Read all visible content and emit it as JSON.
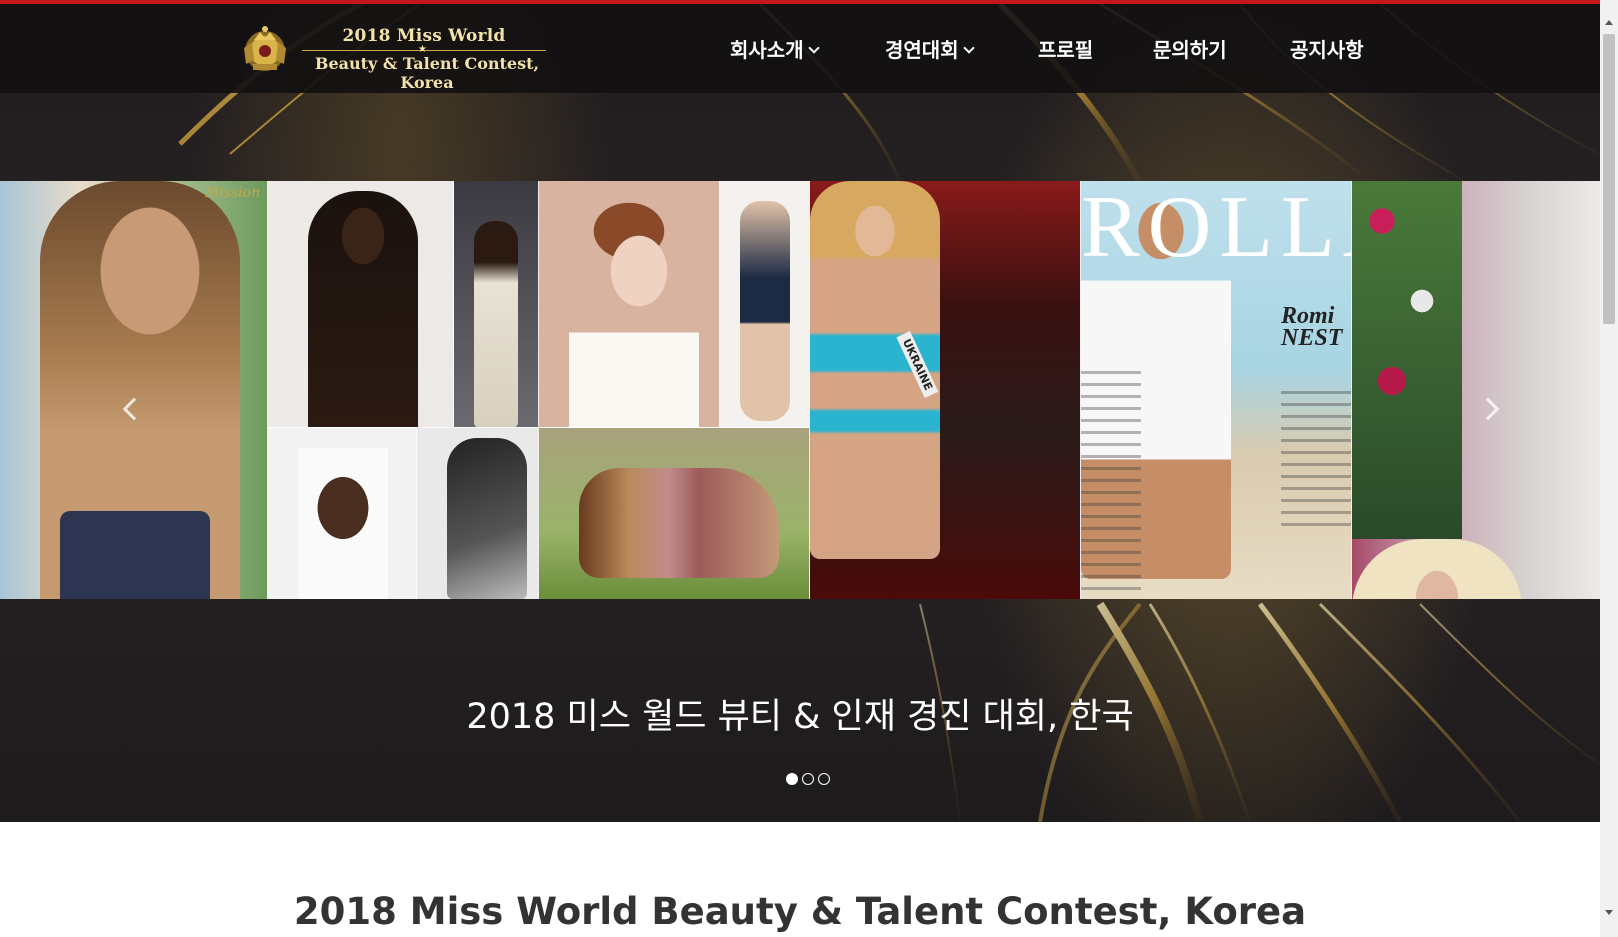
{
  "header": {
    "logo_line1": "2018 Miss World",
    "logo_line2": "Beauty & Talent Contest, Korea",
    "logo_star": "★",
    "nav": [
      {
        "label": "회사소개",
        "has_dropdown": true
      },
      {
        "label": "경연대회",
        "has_dropdown": true
      },
      {
        "label": "프로필",
        "has_dropdown": false
      },
      {
        "label": "문의하기",
        "has_dropdown": false
      },
      {
        "label": "공지사항",
        "has_dropdown": false
      }
    ]
  },
  "slider": {
    "caption": "2018 미스 월드 뷰티 & 인재 경진 대회, 한국",
    "dots_total": 3,
    "active_dot": 1,
    "photo_texts": {
      "magazine_title": "ROLLA",
      "magazine_cover_name": "Romi NEST",
      "sash_text": "UKRAINE",
      "corner_badge": "Mission"
    }
  },
  "main": {
    "heading": "2018 Miss World Beauty & Talent Contest, Korea"
  },
  "colors": {
    "accent_top_line": "#c4161c",
    "logo_gold": "#f2e2a8",
    "header_bg": "#121011"
  }
}
